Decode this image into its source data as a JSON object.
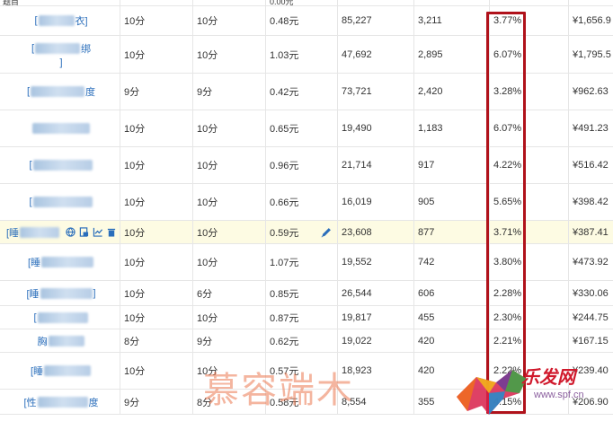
{
  "table": {
    "header_partial": {
      "first": "题目",
      "price": "0.00元"
    },
    "rows": [
      {
        "kw_prefix": "[",
        "kw_suffix": "衣]",
        "c1": "10分",
        "c2": "10分",
        "price": "0.48元",
        "views": "85,227",
        "clicks": "3,211",
        "ctr": "3.77%",
        "cost": "¥1,656.9"
      },
      {
        "kw_prefix": "[",
        "kw_suffix": "绑",
        "kw_line2": "]",
        "c1": "10分",
        "c2": "10分",
        "price": "1.03元",
        "views": "47,692",
        "clicks": "2,895",
        "ctr": "6.07%",
        "cost": "¥1,795.5"
      },
      {
        "kw_prefix": "[",
        "kw_suffix": "度",
        "c1": "9分",
        "c2": "9分",
        "price": "0.42元",
        "views": "73,721",
        "clicks": "2,420",
        "ctr": "3.28%",
        "cost": "¥962.63"
      },
      {
        "kw_prefix": "",
        "kw_suffix": "",
        "c1": "10分",
        "c2": "10分",
        "price": "0.65元",
        "views": "19,490",
        "clicks": "1,183",
        "ctr": "6.07%",
        "cost": "¥491.23"
      },
      {
        "kw_prefix": "[",
        "kw_suffix": "",
        "c1": "10分",
        "c2": "10分",
        "price": "0.96元",
        "views": "21,714",
        "clicks": "917",
        "ctr": "4.22%",
        "cost": "¥516.42"
      },
      {
        "kw_prefix": "[",
        "kw_suffix": "",
        "c1": "10分",
        "c2": "10分",
        "price": "0.66元",
        "views": "16,019",
        "clicks": "905",
        "ctr": "5.65%",
        "cost": "¥398.42"
      },
      {
        "kw_prefix": "[睡",
        "kw_suffix": "",
        "c1": "10分",
        "c2": "10分",
        "price": "0.59元",
        "views": "23,608",
        "clicks": "877",
        "ctr": "3.71%",
        "cost": "¥387.41",
        "highlight": true
      },
      {
        "kw_prefix": "[睡",
        "kw_suffix": "",
        "c1": "10分",
        "c2": "10分",
        "price": "1.07元",
        "views": "19,552",
        "clicks": "742",
        "ctr": "3.80%",
        "cost": "¥473.92"
      },
      {
        "kw_prefix": "[睡",
        "kw_suffix": "]",
        "c1": "10分",
        "c2": "6分",
        "price": "0.85元",
        "views": "26,544",
        "clicks": "606",
        "ctr": "2.28%",
        "cost": "¥330.06"
      },
      {
        "kw_prefix": "[",
        "kw_suffix": "",
        "c1": "10分",
        "c2": "10分",
        "price": "0.87元",
        "views": "19,817",
        "clicks": "455",
        "ctr": "2.30%",
        "cost": "¥244.75"
      },
      {
        "kw_prefix": "胸",
        "kw_suffix": "",
        "c1": "8分",
        "c2": "9分",
        "price": "0.62元",
        "views": "19,022",
        "clicks": "420",
        "ctr": "2.21%",
        "cost": "¥167.15"
      },
      {
        "kw_prefix": "[睡",
        "kw_suffix": "",
        "c1": "10分",
        "c2": "10分",
        "price": "0.57元",
        "views": "18,923",
        "clicks": "420",
        "ctr": "2.22%",
        "cost": "¥239.40"
      },
      {
        "kw_prefix": "[性",
        "kw_suffix": "度",
        "c1": "9分",
        "c2": "8分",
        "price": "0.58元",
        "views": "8,554",
        "clicks": "355",
        "ctr": "4.15%",
        "cost": "¥206.90"
      }
    ]
  },
  "overlay": {
    "watermark_text": "慕容端木",
    "logo_text": "乐发网",
    "logo_url": "www.spf.cn"
  },
  "colors": {
    "link": "#2a6ebb",
    "red_box": "#b0121b",
    "highlight_row": "#fdfbe3"
  },
  "icons": [
    "globe-icon",
    "file-icon",
    "trend-chart-icon",
    "trash-icon",
    "pencil-icon"
  ]
}
